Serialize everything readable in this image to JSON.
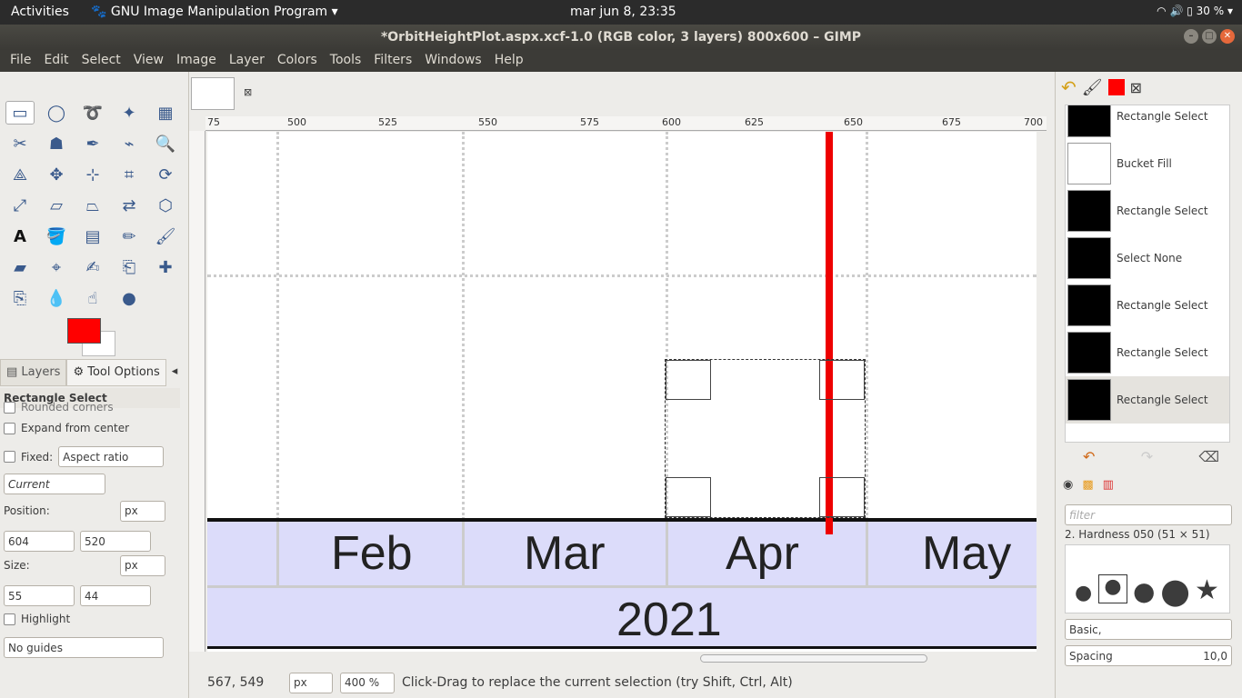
{
  "topbar": {
    "activities": "Activities",
    "app_menu": "GNU Image Manipulation Program",
    "clock": "mar jun  8, 23:35",
    "battery": "30 %"
  },
  "window": {
    "title": "*OrbitHeightPlot.aspx.xcf-1.0 (RGB color, 3 layers) 800x600 – GIMP"
  },
  "menu": [
    "File",
    "Edit",
    "Select",
    "View",
    "Image",
    "Layer",
    "Colors",
    "Tools",
    "Filters",
    "Windows",
    "Help"
  ],
  "colors": {
    "foreground": "#ff0000",
    "background": "#ffffff"
  },
  "dock": {
    "tabs": [
      "Layers",
      "Tool Options"
    ]
  },
  "tool_options": {
    "title": "Rectangle Select",
    "rounded": "Rounded corners",
    "expand": "Expand from center",
    "fixed": "Fixed:",
    "fixed_value": "Aspect ratio",
    "ratio_value": "Current",
    "position_label": "Position:",
    "pos_x": "604",
    "pos_y": "520",
    "size_label": "Size:",
    "size_w": "55",
    "size_h": "44",
    "unit": "px",
    "highlight": "Highlight",
    "guides": "No guides"
  },
  "ruler": {
    "h_ticks": [
      "75",
      "500",
      "525",
      "550",
      "575",
      "600",
      "625",
      "650",
      "675",
      "700"
    ]
  },
  "canvas": {
    "months": [
      "Feb",
      "Mar",
      "Apr",
      "May"
    ],
    "year": "2021"
  },
  "status": {
    "coords": "567, 549",
    "unit": "px",
    "zoom": "400 %",
    "message": "Click-Drag to replace the current selection (try Shift, Ctrl, Alt)"
  },
  "undo": [
    {
      "label": "Rectangle Select"
    },
    {
      "label": "Bucket Fill"
    },
    {
      "label": "Rectangle Select"
    },
    {
      "label": "Select None"
    },
    {
      "label": "Rectangle Select"
    },
    {
      "label": "Rectangle Select"
    },
    {
      "label": "Rectangle Select"
    }
  ],
  "brushes": {
    "filter_placeholder": "filter",
    "current": "2. Hardness 050 (51 × 51)",
    "preset": "Basic,",
    "spacing_label": "Spacing",
    "spacing_value": "10,0"
  }
}
